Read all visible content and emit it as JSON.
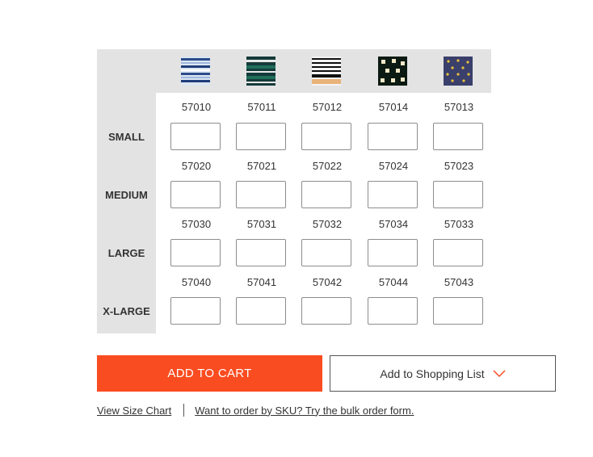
{
  "products": [
    {
      "code": "57010-col",
      "swatch_name": "blue-stripe-swatch"
    },
    {
      "code": "57011-col",
      "swatch_name": "green-stripe-swatch"
    },
    {
      "code": "57012-col",
      "swatch_name": "black-tan-stripe-swatch"
    },
    {
      "code": "57014-col",
      "swatch_name": "black-square-swatch"
    },
    {
      "code": "57013-col",
      "swatch_name": "navy-dot-swatch"
    }
  ],
  "rows": [
    {
      "size": "SMALL",
      "skus": [
        "57010",
        "57011",
        "57012",
        "57014",
        "57013"
      ],
      "quantities": [
        "",
        "",
        "",
        "",
        ""
      ]
    },
    {
      "size": "MEDIUM",
      "skus": [
        "57020",
        "57021",
        "57022",
        "57024",
        "57023"
      ],
      "quantities": [
        "",
        "",
        "",
        "",
        ""
      ]
    },
    {
      "size": "LARGE",
      "skus": [
        "57030",
        "57031",
        "57032",
        "57034",
        "57033"
      ],
      "quantities": [
        "",
        "",
        "",
        "",
        ""
      ]
    },
    {
      "size": "X-LARGE",
      "skus": [
        "57040",
        "57041",
        "57042",
        "57044",
        "57043"
      ],
      "quantities": [
        "",
        "",
        "",
        "",
        ""
      ]
    }
  ],
  "actions": {
    "add_to_cart": "ADD TO CART",
    "add_to_list": "Add to Shopping List"
  },
  "links": {
    "size_chart": "View Size Chart",
    "bulk_order": "Want to order by SKU? Try the bulk order form."
  },
  "colors": {
    "accent": "#fa4c21",
    "panel_gray": "#e3e3e3",
    "text": "#333333"
  },
  "icons": {
    "dropdown": "chevron-down-icon"
  }
}
